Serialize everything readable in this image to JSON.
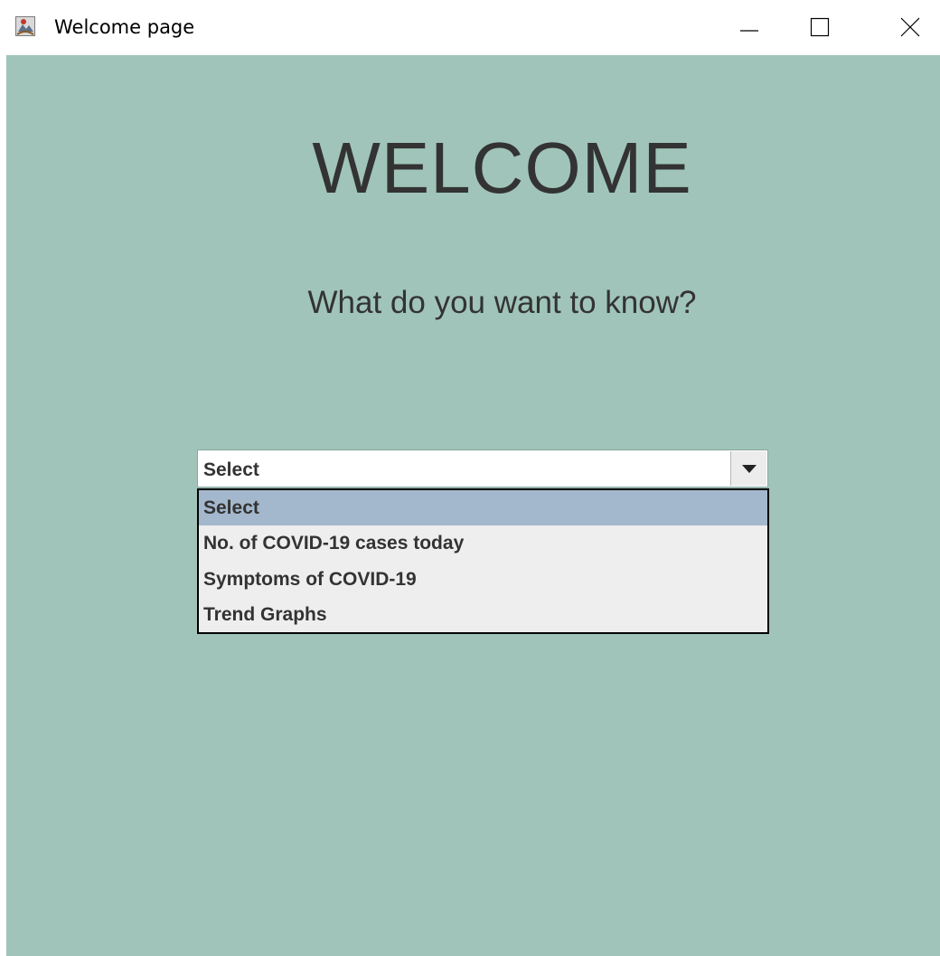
{
  "window": {
    "title": "Welcome page",
    "controls": {
      "minimize": "minimize-icon",
      "maximize": "maximize-icon",
      "close": "close-icon"
    }
  },
  "main": {
    "heading": "WELCOME",
    "question": "What do you want to know?",
    "background_color": "#a0c4b9",
    "combo": {
      "value": "Select",
      "expanded": true,
      "options": [
        "Select",
        "No. of COVID-19 cases today",
        "Symptoms of COVID-19",
        "Trend Graphs"
      ],
      "highlighted_index": 0,
      "highlight_color": "#a4b8cd"
    }
  }
}
